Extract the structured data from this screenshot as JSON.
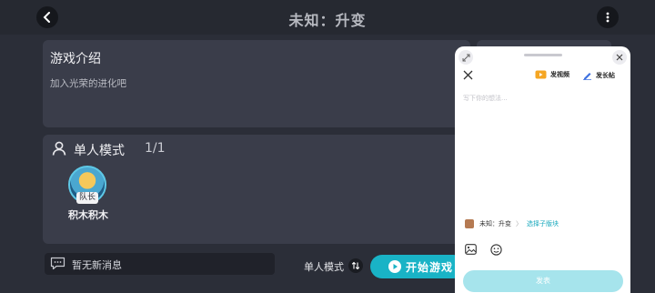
{
  "header": {
    "title": "未知：升变"
  },
  "intro": {
    "heading": "游戏介绍",
    "description": "加入光荣的进化吧"
  },
  "mode_panel": {
    "label": "单人模式",
    "count": "1/1",
    "player": {
      "badge": "队长",
      "name": "积木积木"
    }
  },
  "bottom_bar": {
    "message_placeholder": "暂无新消息",
    "mode_label": "单人模式",
    "start_label": "开始游戏"
  },
  "compose": {
    "video_label": "发视频",
    "long_post_label": "发长帖",
    "editor_placeholder": "写下你的想法...",
    "game_name": "未知：升变",
    "section_link": "选择子版块",
    "publish_label": "发表"
  },
  "colors": {
    "accent": "#19b3c6",
    "publish_disabled": "#a6e4ec",
    "background": "#2b2e38",
    "panel": "#3a3d4a"
  }
}
